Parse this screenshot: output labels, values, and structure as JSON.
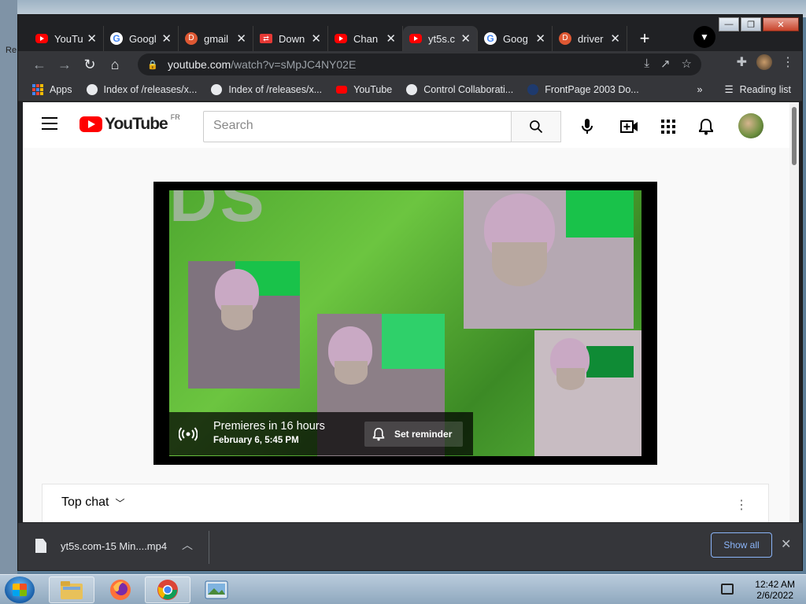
{
  "desktop": {
    "side_label": "Re"
  },
  "window": {
    "controls": [
      "—",
      "❐",
      "✕"
    ]
  },
  "tabs": [
    {
      "title": "YouTu",
      "favicon": "youtube-icon"
    },
    {
      "title": "Googl",
      "favicon": "google-icon"
    },
    {
      "title": "gmail",
      "favicon": "duckduckgo-icon"
    },
    {
      "title": "Down",
      "favicon": "download-icon"
    },
    {
      "title": "Chan",
      "favicon": "youtube-icon"
    },
    {
      "title": "yt5s.c",
      "favicon": "youtube-icon",
      "active": true
    },
    {
      "title": "Goog",
      "favicon": "google-icon"
    },
    {
      "title": "driver",
      "favicon": "duckduckgo-icon"
    }
  ],
  "toolbar": {
    "url_host": "youtube.com",
    "url_path": "/watch?v=sMpJC4NY02E"
  },
  "bookmarks": {
    "items": [
      {
        "label": "Apps",
        "icon": "apps-grid-icon"
      },
      {
        "label": "Index of /releases/x...",
        "icon": "globe-icon"
      },
      {
        "label": "Index of /releases/x...",
        "icon": "globe-icon"
      },
      {
        "label": "YouTube",
        "icon": "youtube-icon"
      },
      {
        "label": "Control Collaborati...",
        "icon": "globe-icon"
      },
      {
        "label": "FrontPage 2003 Do...",
        "icon": "frontpage-icon"
      }
    ],
    "overflow": "»",
    "reading_list": "Reading list"
  },
  "youtube": {
    "logo_text": "YouTube",
    "country_code": "FR",
    "search_placeholder": "Search"
  },
  "premiere": {
    "title": "Premieres in 16 hours",
    "date": "February 6, 5:45 PM",
    "reminder_label": "Set reminder"
  },
  "chat": {
    "title": "Top chat"
  },
  "download": {
    "file_name": "yt5s.com-15 Min....mp4",
    "show_all": "Show all"
  },
  "taskbar": {
    "time": "12:42 AM",
    "date": "2/6/2022"
  }
}
